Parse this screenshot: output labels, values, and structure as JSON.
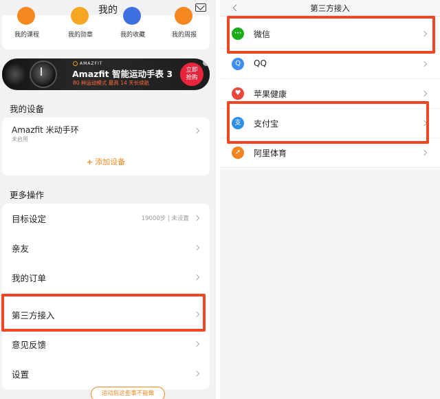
{
  "left": {
    "title": "我的",
    "shortcuts": [
      {
        "label": "我的课程",
        "color": "#f5881f"
      },
      {
        "label": "我的勋章",
        "color": "#f5a623"
      },
      {
        "label": "我的收藏",
        "color": "#3d6fe0"
      },
      {
        "label": "我的周报",
        "color": "#f5881f"
      }
    ],
    "banner": {
      "brand": "AMAZFIT",
      "headline": "Amazfit 智能运动手表 3",
      "sub": "80 种运动模式 最高 14 天长续航",
      "cta_line1": "立即",
      "cta_line2": "抢购"
    },
    "devices": {
      "section_title": "我的设备",
      "name": "Amazfit 米动手环",
      "status": "未启用",
      "add": "添加设备"
    },
    "more": {
      "section_title": "更多操作",
      "items": [
        {
          "label": "目标设定",
          "value": "19000步 | 未设置"
        },
        {
          "label": "亲友",
          "value": ""
        },
        {
          "label": "我的订单",
          "value": ""
        },
        {
          "label": "第三方接入",
          "value": ""
        },
        {
          "label": "意见反馈",
          "value": ""
        },
        {
          "label": "设置",
          "value": ""
        }
      ]
    },
    "bottom_pill": "运动后这些事不能做"
  },
  "right": {
    "title": "第三方接入",
    "items": [
      {
        "label": "微信",
        "color": "#1aad19",
        "icon": "wechat-icon",
        "glyph": "•••"
      },
      {
        "label": "QQ",
        "color": "#3d8ef0",
        "icon": "qq-icon",
        "glyph": "Q"
      },
      {
        "label": "苹果健康",
        "color": "#e8493c",
        "icon": "apple-health-icon",
        "glyph": "♥"
      },
      {
        "label": "支付宝",
        "color": "#2f8fe8",
        "icon": "alipay-icon",
        "glyph": "支"
      },
      {
        "label": "阿里体育",
        "color": "#f0841e",
        "icon": "ali-sports-icon",
        "glyph": "➚"
      }
    ]
  },
  "colors": {
    "highlight": "#ef4623",
    "accent": "#f5881f"
  }
}
